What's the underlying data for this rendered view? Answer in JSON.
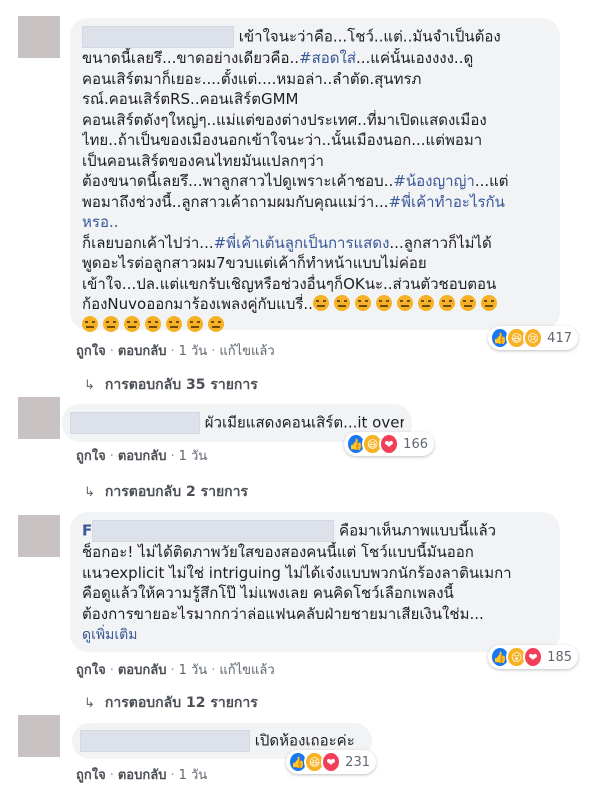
{
  "comment1": {
    "lines": [
      "เข้าใจนะว่าคือ...โชว์..แต่..มันจำเป็นต้อง",
      "ขนาดนี้เลยรึ...ขาดอย่างเดียวคือ..",
      "คอนเสิร์ตมาก็เยอะ....ตั้งแต่....หมอล่า..ลำตัด.สุนทรภ",
      "รณ์.คอนเสิร์ตRS..คอนเสิร์ตGMM",
      "คอนเสิร์ตดังๆใหญ่ๆ..แม่แต่ของต่างประเทศ..ที่มาเปิดแสดงเมือง",
      "ไทย..ถ้าเป็นของเมืองนอกเข้าใจนะว่า..นั้นเมืองนอก...แต่พอมา",
      "เป็นคอนเสิร์ตของคนไทยมันแปลกๆว่า",
      "ต้องขนาดนี้เลยรึ...พาลูกสาวไปดูเพราะเค้าชอบ..",
      "พอมาถึงช่วงนี้..ลูกสาวเค้าถามผมกับคุณแม่ว่า...",
      "หรอ..",
      "ก็เลยบอกเค้าไปว่า...",
      "พูดอะไรต่อลูกสาวผม7ขวบแต่เค้าก็ทำหน้าแบบไม่ค่อย",
      "เข้าใจ...ปล.แต่แขกรับเชิญหรือช่วงอื่นๆก็OKนะ..ส่วนตัวชอบตอน",
      "ก้องNuvoออกมาร้องเพลงคู่กับแบรี่.."
    ],
    "tag_sod": "#สอดใส่",
    "after_tag_sod": "...แค่นั้นเองงงง..ดู",
    "tag_nong": "#น้องญาญ่า",
    "after_tag_nong": "...แต่",
    "tag_phi1": "#พี่เค้าทำอะไรกัน",
    "tag_phi2": "#พี่เค้าเต้นลูกเป็นการแสดง",
    "after_tag_phi2": "...ลูกสาวก็ไม่ได้",
    "reaction_count": "417",
    "actions": {
      "like": "ถูกใจ",
      "reply": "ตอบกลับ",
      "time": "1 วัน",
      "edited": "แก้ไขแล้ว"
    },
    "replies_label": "การตอบกลับ 35 รายการ"
  },
  "comment2": {
    "text": "ผัวเมียแสดงคอนเสิร์ต...it over",
    "reaction_count": "166",
    "actions": {
      "like": "ถูกใจ",
      "reply": "ตอบกลับ",
      "time": "1 วัน"
    },
    "replies_label": "การตอบกลับ 2 รายการ"
  },
  "comment3": {
    "name_initial": "F",
    "line1_after": "คือมาเห็นภาพแบบนี้แล้ว",
    "lines": [
      "ช็อกอะ! ไม่ได้ติดภาพวัยใสของสองคนนี้แต่ โชว์แบบนี้มันออก",
      "แนวexplicit ไม่ใช่ intriguing ไม่ได้เจ๋งแบบพวกนักร้องลาตินเมกา",
      "คือดูแล้วให้ความรู้สึกโป๊ ไม่แพงเลย คนคิดโชว์เลือกเพลงนี้",
      "ต้องการขายอะไรมากกว่าล่อแฟนคลับฝ่ายชายมาเสียเงินใช่ม..."
    ],
    "see_more": "ดูเพิ่มเติม",
    "reaction_count": "185",
    "actions": {
      "like": "ถูกใจ",
      "reply": "ตอบกลับ",
      "time": "1 วัน",
      "edited": "แก้ไขแล้ว"
    },
    "replies_label": "การตอบกลับ 12 รายการ"
  },
  "comment4": {
    "text": "เปิดห้องเถอะค่ะ",
    "reaction_count": "231",
    "actions": {
      "like": "ถูกใจ",
      "reply": "ตอบกลับ",
      "time": "1 วัน"
    }
  },
  "colors": {
    "link": "#385898",
    "bubble": "#f2f3f5",
    "like": "#1877f2",
    "love": "#f33e58",
    "haha": "#f7b125"
  }
}
